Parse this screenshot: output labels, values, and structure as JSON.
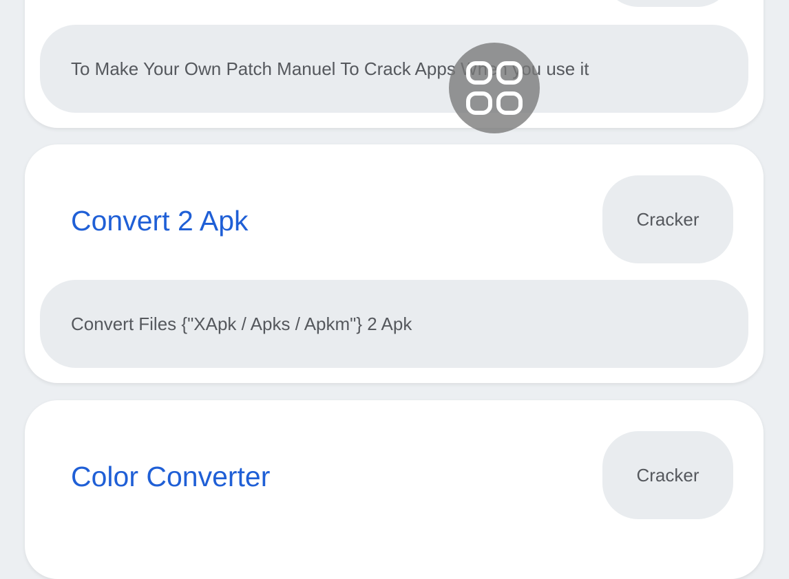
{
  "cards": [
    {
      "title": "",
      "tag": "",
      "description": "To Make Your Own Patch Manuel To Crack Apps When you use it"
    },
    {
      "title": "Convert 2 Apk",
      "tag": "Cracker",
      "description": "Convert Files {\"XApk / Apks / Apkm\"} 2 Apk"
    },
    {
      "title": "Color Converter",
      "tag": "Cracker",
      "description": ""
    }
  ],
  "floating_button": {
    "icon": "grid-apps-icon"
  },
  "colors": {
    "background": "#eceff2",
    "card": "#ffffff",
    "title": "#1f5fd6",
    "pill": "#e9ecef",
    "text": "#55585d"
  }
}
